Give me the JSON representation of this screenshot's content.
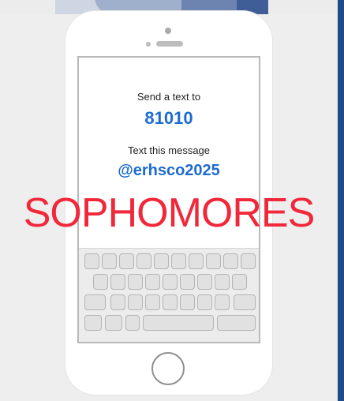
{
  "screen": {
    "send_label": "Send a text to",
    "number": "81010",
    "message_label": "Text this message",
    "code": "@erhsco2025"
  },
  "overlay_text": "SOPHOMORES",
  "colors": {
    "accent_blue": "#1d6bd0",
    "overlay_red": "#f0283a",
    "right_bar": "#1f4c86"
  },
  "icons": [
    "camera-icon",
    "speaker-icon",
    "home-button-icon",
    "keyboard-keys"
  ]
}
